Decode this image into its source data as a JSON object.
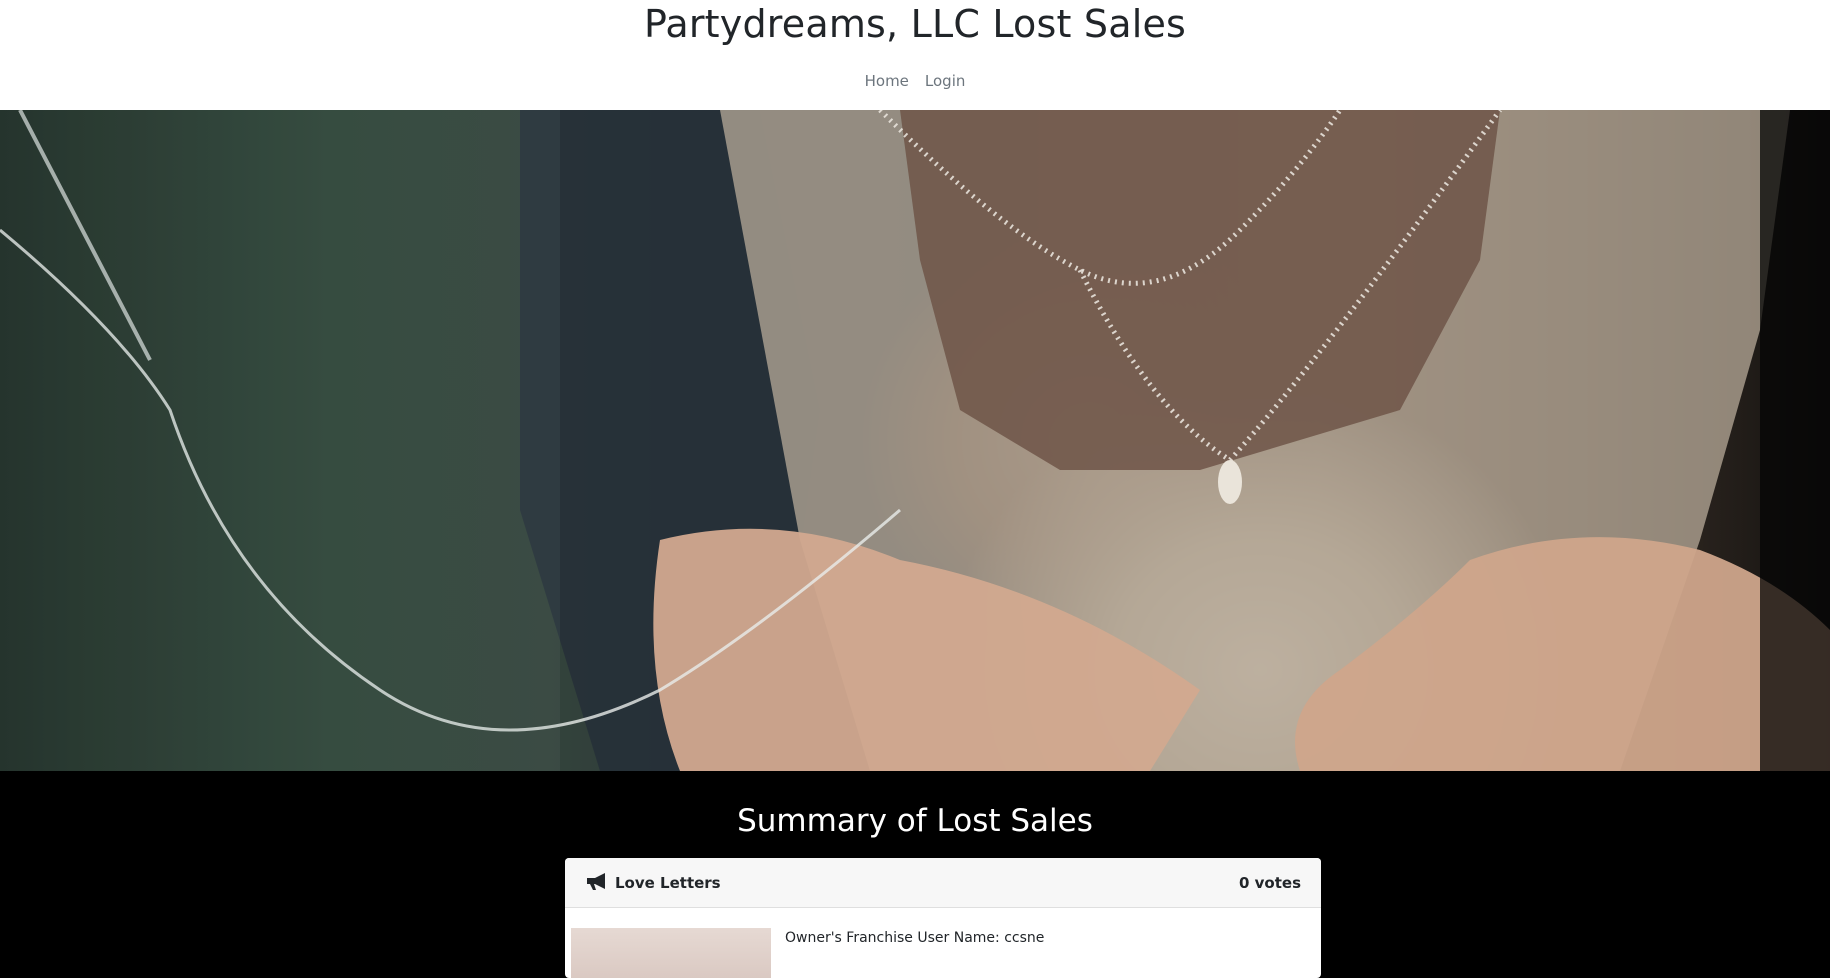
{
  "header": {
    "title": "Partydreams, LLC Lost Sales",
    "nav": [
      "Home",
      "Login"
    ]
  },
  "hero": {
    "image": "wedding-photo"
  },
  "summary": {
    "title": "Summary of Lost Sales",
    "cards": [
      {
        "title": "Love Letters",
        "votes": "0 votes",
        "owner_line": "Owner's Franchise User Name: ccsne"
      }
    ]
  },
  "icons": {
    "card_header": "megaphone-icon"
  },
  "colors": {
    "header_bg": "#ffffff",
    "page_bg": "#000000",
    "nav_link": "#6c757d",
    "title_text": "#212529",
    "card_header_bg": "#f7f7f7"
  }
}
